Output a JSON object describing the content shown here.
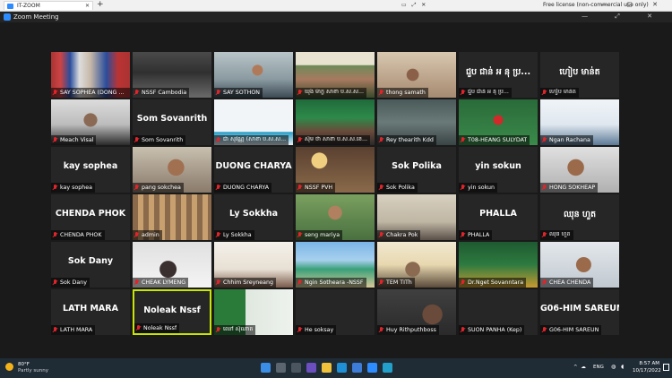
{
  "browser": {
    "tab_title": "IT-ZOOM",
    "license_text": "Free license (non-commercial use only)"
  },
  "zoom": {
    "window_title": "Zoom Meeting"
  },
  "participants": [
    {
      "label": "SAY SOPHEA (DONG K...",
      "video": true,
      "v": "flags"
    },
    {
      "label": "NSSF Cambodia",
      "video": true,
      "v": "dark"
    },
    {
      "label": "SAY SOTHON",
      "video": true,
      "v": "office"
    },
    {
      "label": "ឃុង ម៉ាក្ល សាខា ប.ស.ស...",
      "video": true,
      "v": "banner"
    },
    {
      "label": "thong samath",
      "video": true,
      "v": "room"
    },
    {
      "label": "ជួប ជាន់ អ នុ ប្រ...",
      "name": "ជួប ជាន់ អ នុ ប្រ...",
      "video": false
    },
    {
      "label": "ហៀប មាន់ត",
      "name": "ហៀប មាន់ត",
      "video": false
    },
    {
      "label": "Meach Visal",
      "video": true,
      "v": "glasses"
    },
    {
      "label": "Som Sovanrith",
      "name": "Som Sovanrith",
      "video": false
    },
    {
      "label": "ជា សុវណ្ណ (សាខា ប.ស.ស...",
      "video": true,
      "v": "slide"
    },
    {
      "label": "ស៊ីម ថា សាខា ប.ស.ស.ខេ...",
      "video": true,
      "v": "green"
    },
    {
      "label": "Rey thearith Kdd",
      "video": true,
      "v": "ceiling"
    },
    {
      "label": "T08-HEANG SULYDAT",
      "video": true,
      "v": "logo"
    },
    {
      "label": "Ngan Rachana",
      "video": true,
      "v": "screen"
    },
    {
      "label": "kay sophea",
      "name": "kay sophea",
      "video": false
    },
    {
      "label": "pang sokchea",
      "video": true,
      "v": "face"
    },
    {
      "label": "DUONG CHARYA",
      "name": "DUONG CHARYA",
      "video": false
    },
    {
      "label": "NSSF PVH",
      "video": true,
      "v": "lamp"
    },
    {
      "label": "Sok Polika",
      "name": "Sok Polika",
      "video": false
    },
    {
      "label": "yin sokun",
      "name": "yin sokun",
      "video": false
    },
    {
      "label": "HONG SOKHEAP",
      "video": true,
      "v": "face2"
    },
    {
      "label": "CHENDA PHOK",
      "name": "CHENDA PHOK",
      "video": false
    },
    {
      "label": "admin",
      "video": true,
      "v": "shelf"
    },
    {
      "label": "Ly Sokkha",
      "name": "Ly Sokkha",
      "video": false
    },
    {
      "label": "seng mariya",
      "video": true,
      "v": "lady"
    },
    {
      "label": "Chakra Pok",
      "video": true,
      "v": "wall"
    },
    {
      "label": "PHALLA",
      "name": "PHALLA",
      "video": false
    },
    {
      "label": "ឈុន ហួត",
      "name": "ឈុន ហួត",
      "video": false
    },
    {
      "label": "Sok Dany",
      "name": "Sok Dany",
      "video": false
    },
    {
      "label": "CHEAK LYMENG",
      "video": true,
      "v": "desk"
    },
    {
      "label": "Chhim Sreyneang",
      "video": true,
      "v": "bright"
    },
    {
      "label": "Ngin Sotheara -NSSF",
      "video": true,
      "v": "beach"
    },
    {
      "label": "TEM TITh",
      "video": true,
      "v": "banner2"
    },
    {
      "label": "Dr.Nget Sovanntara",
      "video": true,
      "v": "logo2"
    },
    {
      "label": "CHEA CHENDA",
      "video": true,
      "v": "office2"
    },
    {
      "label": "LATH MARA",
      "name": "LATH MARA",
      "video": false
    },
    {
      "label": "Noleak Nssf",
      "name": "Noleak Nssf",
      "video": false,
      "active": true
    },
    {
      "label": "ឈៅ ស៊ីណាត",
      "video": true,
      "v": "present"
    },
    {
      "label": "He soksay",
      "video": false
    },
    {
      "label": "Huy Rithputhboss",
      "video": true,
      "v": "dark2"
    },
    {
      "label": "SUON PANHA (Kep)",
      "video": false
    },
    {
      "label": "G06-HIM SAREUN",
      "name": "G06-HIM SAREUN",
      "video": false
    }
  ],
  "taskbar": {
    "temperature": "80°F",
    "weather": "Partly sunny",
    "language": "ENG",
    "time": "8:57 AM",
    "date": "10/17/2022"
  }
}
